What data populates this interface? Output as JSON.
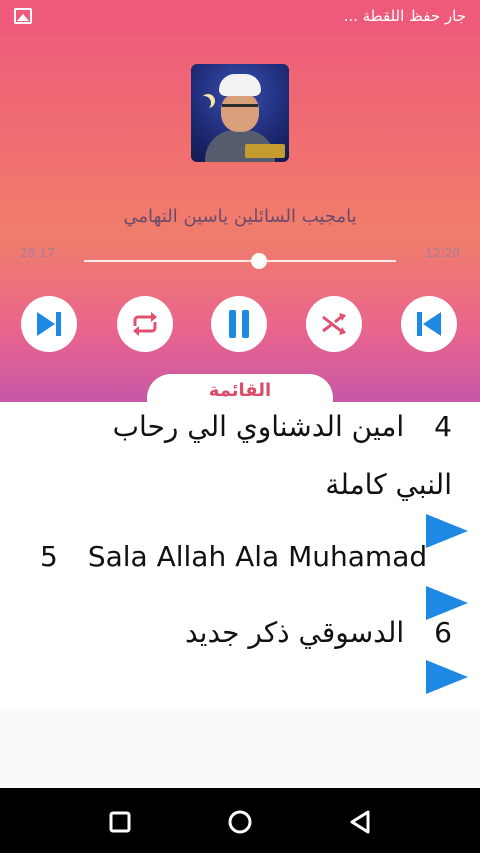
{
  "status_bar": {
    "notification_text": "جار حفظ اللقطة ...",
    "icon": "image-icon"
  },
  "player": {
    "cover_icon": "album-cover",
    "track_title": "يامجيب السائلين  ياسين التهامي",
    "elapsed_time": "28:17",
    "total_time": "12:20",
    "progress": 0.56,
    "controls": [
      {
        "name": "skip-next-icon"
      },
      {
        "name": "repeat-icon"
      },
      {
        "name": "pause-icon"
      },
      {
        "name": "shuffle-icon"
      },
      {
        "name": "skip-previous-icon"
      }
    ],
    "accent_color": "#1e88e5",
    "list_tab_label": "القائمة"
  },
  "playlist": {
    "items": [
      {
        "number": "4",
        "title_line1": "امين الدشناوي الي رحاب",
        "title_line2": "النبي كاملة"
      },
      {
        "number": "5",
        "title_line1": "Sala Allah Ala Muhamad"
      },
      {
        "number": "6",
        "title_line1": "الدسوقي ذكر جديد"
      }
    ]
  },
  "nav_bar": {
    "recents_icon": "square-icon",
    "home_icon": "circle-icon",
    "back_icon": "triangle-back-icon"
  }
}
